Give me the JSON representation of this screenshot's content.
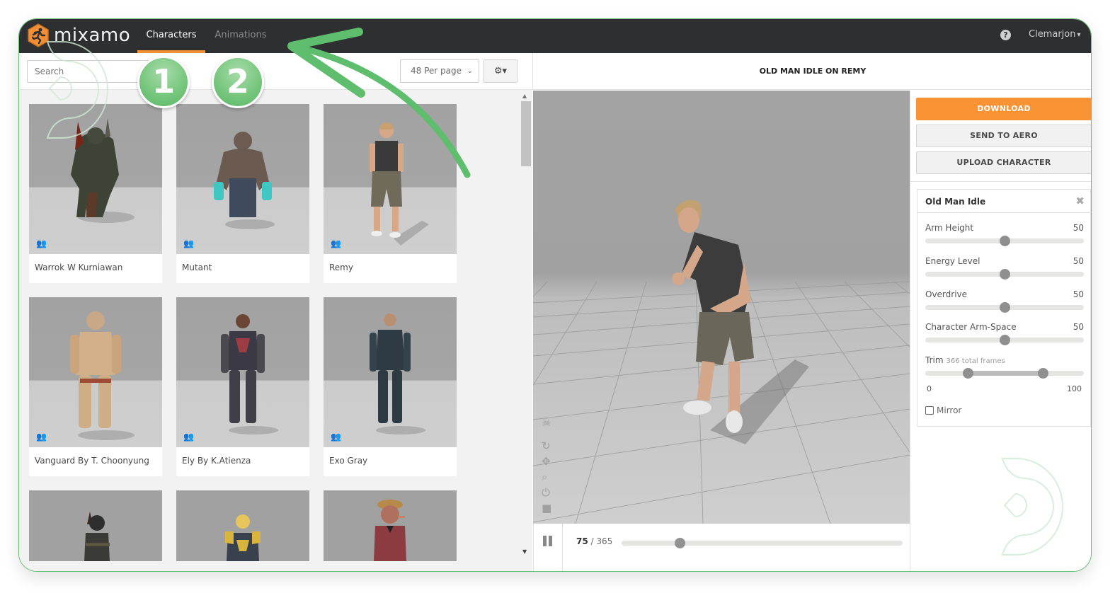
{
  "app": {
    "logo_text": "mixamo",
    "brand_color": "#f08f35"
  },
  "nav": {
    "tabs": [
      {
        "label": "Characters",
        "active": true
      },
      {
        "label": "Animations",
        "active": false
      }
    ],
    "help_icon": "question-circle-icon",
    "help_glyph": "?",
    "user": "Clemarjon",
    "user_caret": "▾"
  },
  "toolbar": {
    "search_placeholder": "Search",
    "per_page": "48 Per page",
    "per_page_chevron": "⌄",
    "settings_glyph": "⚙▾"
  },
  "characters": [
    {
      "name": "Warrok W Kurniawan"
    },
    {
      "name": "Mutant"
    },
    {
      "name": "Remy"
    },
    {
      "name": "Vanguard By T. Choonyung"
    },
    {
      "name": "Ely By K.Atienza"
    },
    {
      "name": "Exo Gray"
    },
    {
      "name": ""
    },
    {
      "name": ""
    },
    {
      "name": ""
    }
  ],
  "viewer": {
    "title": "OLD MAN IDLE ON REMY",
    "tools": [
      "skeleton-icon",
      "rotate-icon",
      "pan-icon",
      "zoom-icon",
      "power-icon",
      "camera-icon"
    ],
    "current_frame": "75",
    "separator": " / ",
    "total_frames": "365",
    "progress_fraction": 0.2055
  },
  "actions": {
    "download": "DOWNLOAD",
    "send_to_aero": "SEND TO AERO",
    "upload_character": "UPLOAD CHARACTER",
    "download_color": "#f99333"
  },
  "animation_panel": {
    "title": "Old Man Idle",
    "close_glyph": "✖",
    "params": [
      {
        "label": "Arm Height",
        "value": "50",
        "fraction": 0.5
      },
      {
        "label": "Energy Level",
        "value": "50",
        "fraction": 0.5
      },
      {
        "label": "Overdrive",
        "value": "50",
        "fraction": 0.5
      },
      {
        "label": "Character Arm-Space",
        "value": "50",
        "fraction": 0.5
      }
    ],
    "trim": {
      "label": "Trim",
      "sub": "366 total frames",
      "min_label": "0",
      "max_label": "100",
      "start_fraction": 0.27,
      "end_fraction": 0.74
    },
    "mirror_label": "Mirror",
    "mirror_checked": false
  },
  "annotations": {
    "badges": [
      "1",
      "2"
    ],
    "accent_color": "#5fbd6e"
  }
}
